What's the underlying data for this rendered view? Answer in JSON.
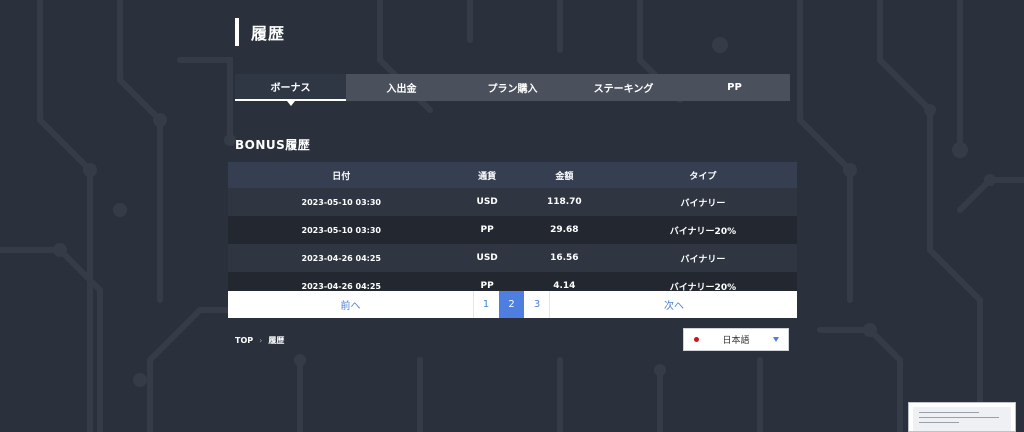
{
  "page": {
    "title": "履歴"
  },
  "tabs": [
    {
      "label": "ボーナス",
      "active": true
    },
    {
      "label": "入出金",
      "active": false
    },
    {
      "label": "プラン購入",
      "active": false
    },
    {
      "label": "ステーキング",
      "active": false
    },
    {
      "label": "PP",
      "active": false
    }
  ],
  "section": {
    "title": "BONUS履歴"
  },
  "table": {
    "headers": [
      "日付",
      "通貨",
      "金額",
      "タイプ"
    ],
    "rows": [
      [
        "2023-05-10 03:30",
        "USD",
        "118.70",
        "バイナリー"
      ],
      [
        "2023-05-10 03:30",
        "PP",
        "29.68",
        "バイナリー20%"
      ],
      [
        "2023-04-26 04:25",
        "USD",
        "16.56",
        "バイナリー"
      ],
      [
        "2023-04-26 04:25",
        "PP",
        "4.14",
        "バイナリー20%"
      ]
    ]
  },
  "pagination": {
    "prev_label": "前へ",
    "next_label": "次へ",
    "pages": [
      "1",
      "2",
      "3"
    ],
    "current": "2"
  },
  "breadcrumb": {
    "home": "TOP",
    "current": "履歴"
  },
  "language": {
    "selected": "日本語"
  },
  "colors": {
    "background": "#2b313c",
    "accent": "#4d7ee0",
    "link": "#4c7fd6"
  }
}
